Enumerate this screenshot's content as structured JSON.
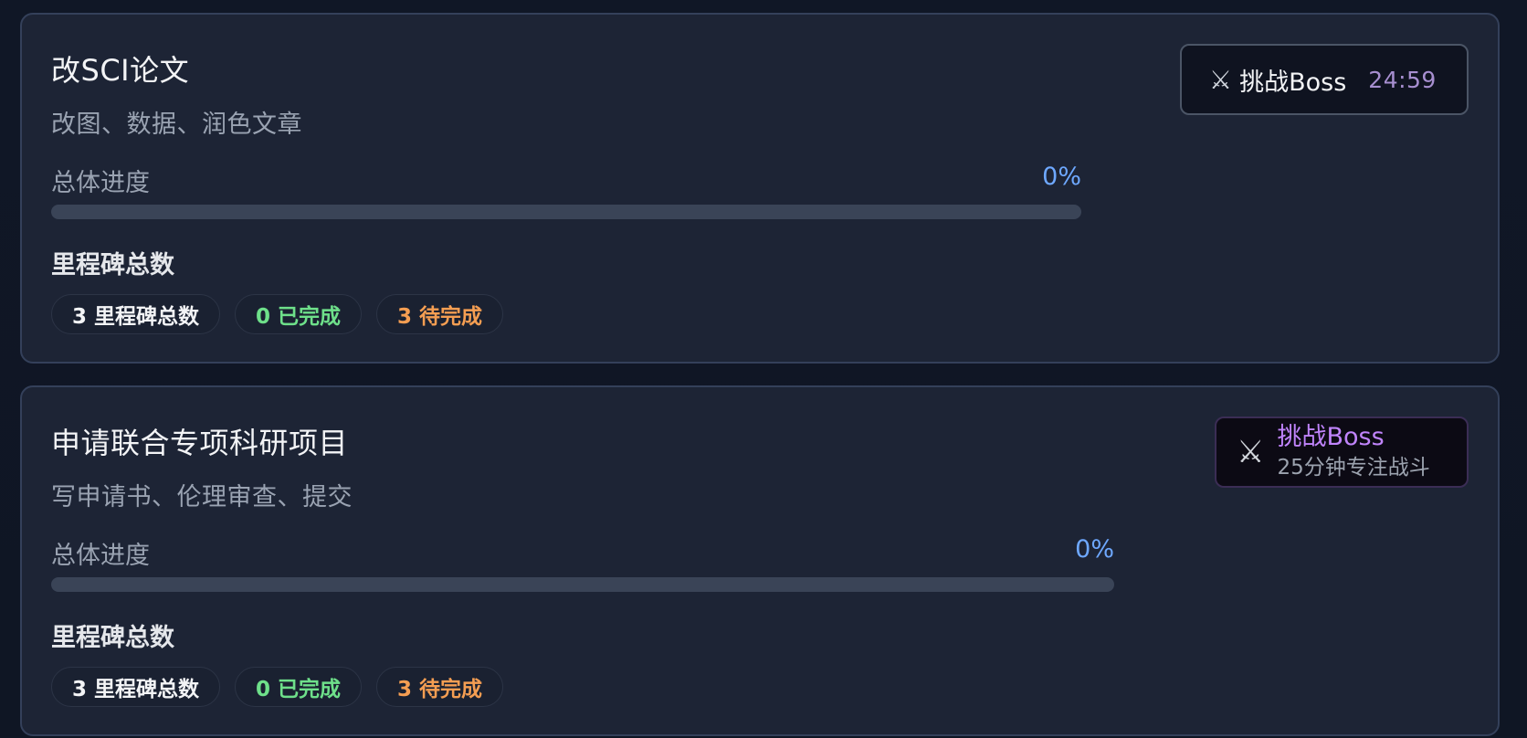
{
  "projects": [
    {
      "title": "改SCI论文",
      "subtitle": "改图、数据、润色文章",
      "progress_label": "总体进度",
      "progress_pct_text": "0%",
      "progress_value": 0,
      "milestones_title": "里程碑总数",
      "chips": {
        "total": "3 里程碑总数",
        "done": "0 已完成",
        "todo": "3 待完成"
      },
      "boss": {
        "icon": "crossed-swords-icon",
        "label": "挑战Boss",
        "timer": "24:59"
      }
    },
    {
      "title": "申请联合专项科研项目",
      "subtitle": "写申请书、伦理审查、提交",
      "progress_label": "总体进度",
      "progress_pct_text": "0%",
      "progress_value": 0,
      "milestones_title": "里程碑总数",
      "chips": {
        "total": "3 里程碑总数",
        "done": "0 已完成",
        "todo": "3 待完成"
      },
      "boss": {
        "icon": "crossed-swords-icon",
        "label": "挑战Boss",
        "desc": "25分钟专注战斗"
      }
    }
  ],
  "colors": {
    "background": "#111827",
    "card": "#1d2435",
    "progress_accent": "#6ea8ff",
    "done": "#6ee08a",
    "todo": "#f59e52",
    "boss_accent": "#c084fc"
  }
}
